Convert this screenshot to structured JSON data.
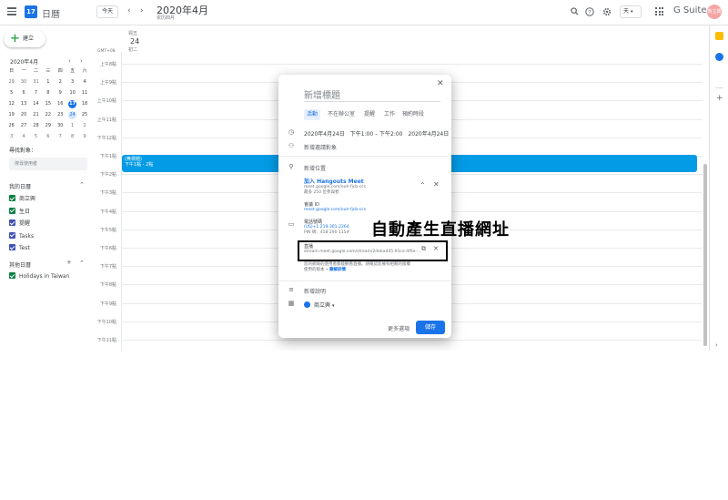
{
  "header": {
    "app_logo_day": "17",
    "app_title": "日曆",
    "today_label": "今天",
    "date_title": "2020年4月",
    "date_subtitle": "农历四月",
    "view_select": "天",
    "gsuite_label": "G Suite",
    "avatar_text": "商立興"
  },
  "sidebar": {
    "create_label": "建立",
    "mini_month": "2020年4月",
    "weekdays": [
      "日",
      "一",
      "二",
      "三",
      "四",
      "五",
      "六"
    ],
    "weeks": [
      [
        "29",
        "30",
        "31",
        "1",
        "2",
        "3",
        "4"
      ],
      [
        "5",
        "6",
        "7",
        "8",
        "9",
        "10",
        "11"
      ],
      [
        "12",
        "13",
        "14",
        "15",
        "16",
        "17",
        "18"
      ],
      [
        "19",
        "20",
        "21",
        "22",
        "23",
        "24",
        "25"
      ],
      [
        "26",
        "27",
        "28",
        "29",
        "30",
        "1",
        "2"
      ],
      [
        "3",
        "4",
        "5",
        "6",
        "7",
        "8",
        "9"
      ]
    ],
    "today": "17",
    "selected": "24",
    "meet_heading": "尋找對象：",
    "search_placeholder": "搜尋使用者",
    "my_calendars_title": "我的日曆",
    "my_calendars": [
      {
        "label": "商立興",
        "color": "#0b8043"
      },
      {
        "label": "生日",
        "color": "#0b8043"
      },
      {
        "label": "提醒",
        "color": "#3f51b5"
      },
      {
        "label": "Tasks",
        "color": "#3f51b5"
      },
      {
        "label": "Test",
        "color": "#3f51b5"
      }
    ],
    "other_calendars_title": "其他日曆",
    "other_calendars": [
      {
        "label": "Holidays in Taiwan",
        "color": "#0b8043"
      }
    ]
  },
  "day_view": {
    "dow": "週五",
    "day_num": "24",
    "day_sub": "初二",
    "timezone": "GMT+08",
    "hours": [
      "上午8點",
      "上午9點",
      "上午10點",
      "上午11點",
      "下午12點",
      "下午1點",
      "下午2點",
      "下午3點",
      "下午4點",
      "下午5點",
      "下午6點",
      "下午7點",
      "下午8點",
      "下午9點",
      "下午10點",
      "下午11點"
    ],
    "event_title": "(無標題)",
    "event_time": "下午1點 - 2點"
  },
  "dialog": {
    "title_placeholder": "新增標題",
    "tabs": [
      "活動",
      "不在辦公室",
      "提醒",
      "工作",
      "預約時段"
    ],
    "datetime": "2020年4月24日　下午1:00 – 下午2:00　2020年4月24日",
    "add_guests": "新增邀請對象",
    "add_location": "新增位置",
    "join_hangouts": "加入 Hangouts Meet",
    "meet_link": "meet.google.com/ouh-fjcb-ccs",
    "meet_limit": "最多 250 位參與者",
    "meeting_id_label": "會議 ID",
    "meeting_id": "meet.google.com/ouh-fjcb-ccs",
    "phone_label": "電話號碼",
    "phone": "(US)+1 219-301-2264",
    "pin": "PIN 碼：458 290 115#",
    "stream_label": "直播",
    "stream_url": "stream.meet.google.com/stream/2debad45-91ce-4f6e-...",
    "stream_note": "您的網域的使用者都能觀看直播。請確認您擁有相關的版權",
    "stream_note2": "使用的版本 •",
    "stream_note_link": "瞭解詳情",
    "add_description": "新增說明",
    "owner": "商立興",
    "more_options": "更多選項",
    "save": "儲存"
  },
  "annotation": "自動產生直播網址"
}
